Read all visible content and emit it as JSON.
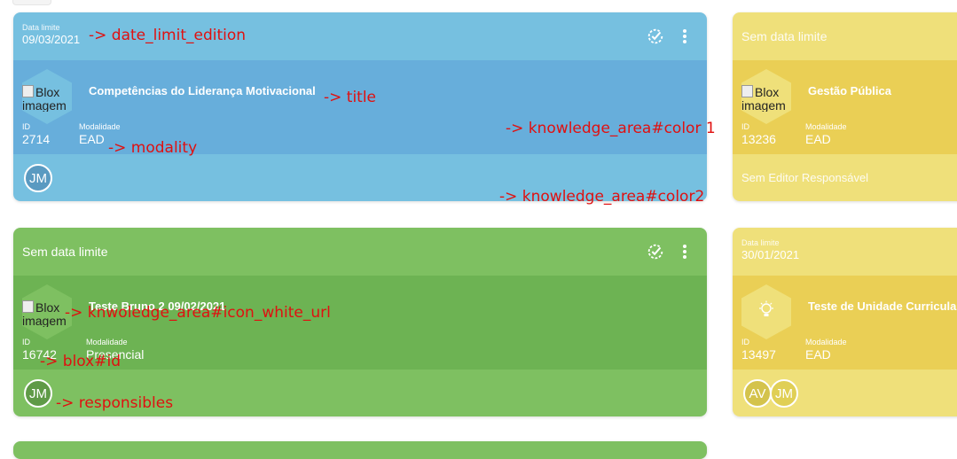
{
  "cards": {
    "c1": {
      "date_label": "Data limite",
      "date_value": "09/03/2021",
      "title": "Competências do Liderança Motivacional",
      "img_alt": "Blox imagem",
      "id_label": "ID",
      "id_value": "2714",
      "modality_label": "Modalidade",
      "modality_value": "EAD",
      "avatar": "JM",
      "colors": {
        "primary": "#76c0e0",
        "secondary": "#67aedb"
      }
    },
    "c2": {
      "no_date": "Sem data limite",
      "title": "Gestão Pública",
      "img_alt": "Blox imagem",
      "id_label": "ID",
      "id_value": "13236",
      "modality_label": "Modalidade",
      "modality_value": "EAD",
      "no_editor": "Sem Editor Responsável",
      "colors": {
        "primary": "#efe07a",
        "secondary": "#eacf55"
      }
    },
    "c3": {
      "no_date": "Sem data limite",
      "title": "Teste Bruno 2 09/02/2021",
      "img_alt": "Blox imagem",
      "id_label": "ID",
      "id_value": "16742",
      "modality_label": "Modalidade",
      "modality_value": "Presencial",
      "avatar": "JM",
      "colors": {
        "primary": "#7ec061",
        "secondary": "#6db353"
      }
    },
    "c4": {
      "date_label": "Data limite",
      "date_value": "30/01/2021",
      "title": "Teste de Unidade Curricular",
      "id_label": "ID",
      "id_value": "13497",
      "modality_label": "Modalidade",
      "modality_value": "EAD",
      "avatars": [
        "AV",
        "JM"
      ],
      "colors": {
        "primary": "#efe07a",
        "secondary": "#eacf55"
      }
    }
  },
  "annotations": {
    "date_limit": "-> date_limit_edition",
    "title": "-> title",
    "modality": "-> modality",
    "color1": "-> knowledge_area#color 1",
    "color2": "-> knowledge_area#color2",
    "icon": "-> knwoledge_area#icon_white_url",
    "blox_id": "-> blox#id",
    "responsibles": "-> responsibles"
  },
  "icons": {
    "sync": "sync-check-icon",
    "more": "more-vertical-icon",
    "bulb": "lightbulb-icon"
  }
}
